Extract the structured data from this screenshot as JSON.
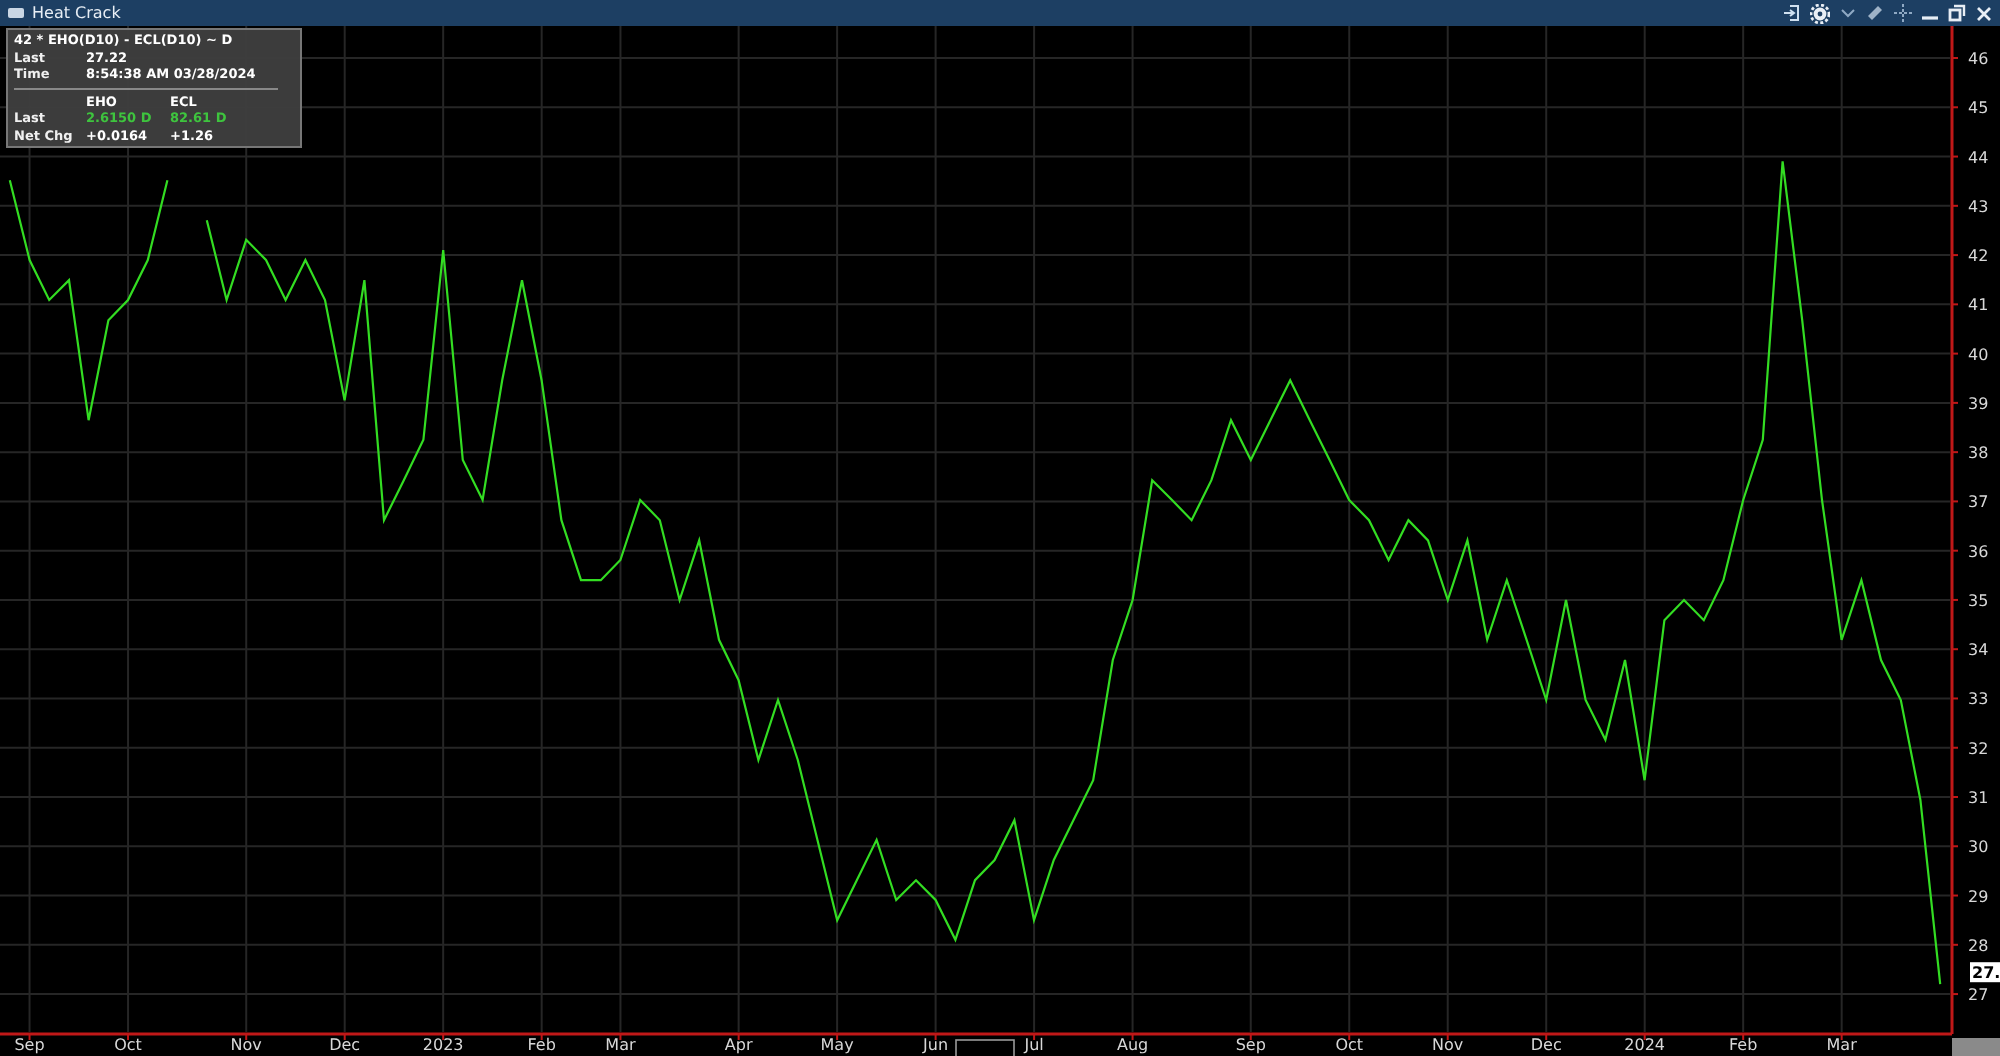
{
  "window": {
    "title": "Heat Crack"
  },
  "info": {
    "heading": "42 * EHO(D10) - ECL(D10) ~ D",
    "summary": [
      {
        "label": "Last",
        "value": "27.22"
      },
      {
        "label": "Time",
        "value": "8:54:38 AM 03/28/2024"
      }
    ],
    "legs": [
      {
        "name": "EHO",
        "last": "2.6150 D",
        "net_chg": "+0.0164"
      },
      {
        "name": "ECL",
        "last": "82.61 D",
        "net_chg": "+1.26"
      }
    ],
    "row_labels": [
      "Last",
      "Net Chg"
    ]
  },
  "last_tag": "27.",
  "chart_data": {
    "type": "line",
    "grid": true,
    "ylim": [
      26.23,
      46.65
    ],
    "yticks": [
      27,
      28,
      29,
      30,
      31,
      32,
      33,
      34,
      35,
      36,
      37,
      38,
      39,
      40,
      41,
      42,
      43,
      44,
      45,
      46
    ],
    "categories": [
      null,
      "Sep",
      null,
      null,
      null,
      null,
      "Oct",
      null,
      null,
      null,
      null,
      null,
      "Nov",
      null,
      null,
      null,
      null,
      "Dec",
      null,
      null,
      null,
      null,
      "2023",
      null,
      null,
      null,
      null,
      "Feb",
      null,
      null,
      null,
      "Mar",
      null,
      null,
      null,
      null,
      null,
      "Apr",
      null,
      null,
      null,
      null,
      "May",
      null,
      null,
      null,
      null,
      "Jun",
      null,
      null,
      null,
      null,
      "Jul",
      null,
      null,
      null,
      null,
      "Aug",
      null,
      null,
      null,
      null,
      null,
      "Sep",
      null,
      null,
      null,
      null,
      "Oct",
      null,
      null,
      null,
      null,
      "Nov",
      null,
      null,
      null,
      null,
      "Dec",
      null,
      null,
      null,
      null,
      "2024",
      null,
      null,
      null,
      null,
      "Feb",
      null,
      null,
      null,
      null,
      "Mar",
      null,
      null,
      null,
      null,
      null
    ],
    "series": [
      {
        "color": "#33dd22",
        "values": [
          43.52,
          41.9,
          41.09,
          41.49,
          38.65,
          40.68,
          41.09,
          41.9,
          43.52,
          null,
          42.71,
          41.09,
          42.31,
          41.9,
          41.09,
          41.9,
          41.09,
          39.05,
          41.49,
          36.62,
          37.43,
          38.25,
          42.1,
          37.84,
          37.03,
          39.46,
          41.49,
          39.46,
          36.62,
          35.4,
          35.4,
          35.81,
          37.03,
          36.62,
          35.0,
          36.21,
          34.19,
          33.37,
          31.75,
          32.97,
          31.75,
          30.13,
          28.5,
          29.31,
          30.13,
          28.91,
          29.31,
          28.91,
          28.1,
          29.31,
          29.72,
          30.53,
          28.5,
          29.72,
          30.53,
          31.34,
          33.78,
          35.0,
          37.43,
          37.03,
          36.62,
          37.43,
          38.65,
          37.84,
          38.65,
          39.46,
          38.65,
          37.84,
          37.03,
          36.62,
          35.81,
          36.62,
          36.21,
          35.0,
          36.21,
          34.19,
          35.4,
          34.19,
          32.97,
          35.0,
          32.97,
          32.16,
          33.78,
          31.34,
          34.59,
          35.0,
          34.59,
          35.4,
          37.03,
          38.25,
          43.9,
          40.68,
          37.03,
          34.19,
          35.4,
          33.78,
          32.97,
          30.94,
          27.2
        ]
      }
    ]
  }
}
